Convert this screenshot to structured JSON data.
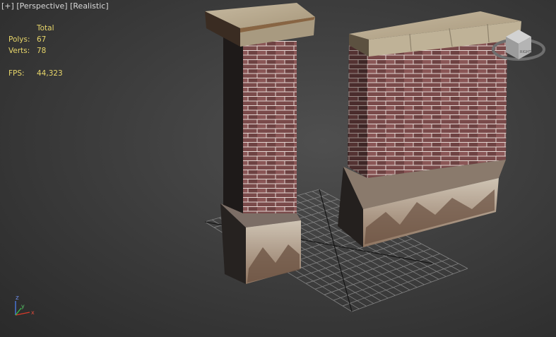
{
  "viewport": {
    "menu": {
      "plus": "[+]",
      "view": "[Perspective]",
      "shading": "[Realistic]"
    },
    "stats": {
      "header": "Total",
      "polys_label": "Polys:",
      "polys_value": "67",
      "verts_label": "Verts:",
      "verts_value": "78",
      "fps_label": "FPS:",
      "fps_value": "44,323"
    },
    "viewcube": {
      "label": "RIGHT",
      "icon": "viewcube-icon"
    },
    "axis_tripod": {
      "x": "x",
      "y": "y",
      "z": "z",
      "icon": "axis-tripod-icon"
    },
    "colors": {
      "label_text": "#d8d8d8",
      "stats_text": "#e8d66a",
      "brick": "#7a4a4a",
      "cap_stone": "#b4a88e",
      "axis_x": "#d83a2a",
      "axis_y": "#3ab84a",
      "axis_z": "#4a78e0"
    }
  }
}
